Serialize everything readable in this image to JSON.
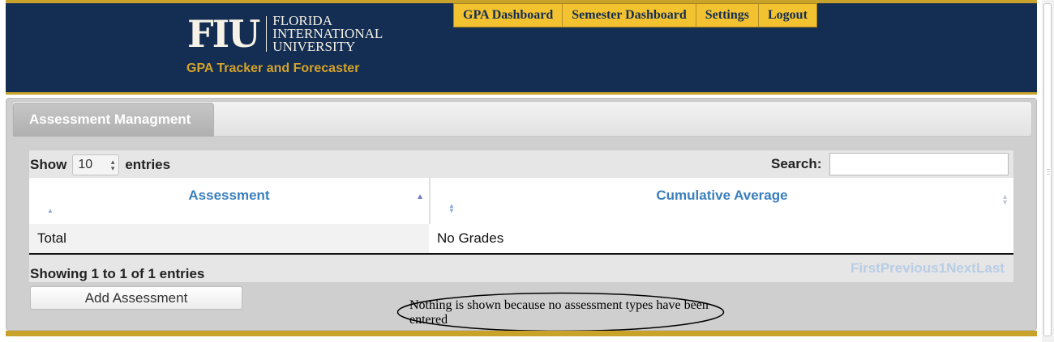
{
  "header": {
    "logo_wordmark": "FIU",
    "logo_line1": "FLORIDA",
    "logo_line2": "INTERNATIONAL",
    "logo_line3": "UNIVERSITY",
    "tagline": "GPA Tracker and Forecaster",
    "nav": [
      "GPA Dashboard",
      "Semester Dashboard",
      "Settings",
      "Logout"
    ]
  },
  "tabs": [
    {
      "label": "Assessment Managment",
      "active": true
    }
  ],
  "table_controls": {
    "show_label": "Show",
    "entries_label": "entries",
    "page_length": "10",
    "search_label": "Search:",
    "search_value": ""
  },
  "table": {
    "columns": [
      "Assessment",
      "Cumulative Average"
    ],
    "rows": [
      [
        "Total",
        "No Grades"
      ]
    ]
  },
  "table_info": "Showing 1 to 1 of 1 entries",
  "pagination": {
    "first": "First",
    "previous": "Previous",
    "page": "1",
    "next": "Next",
    "last": "Last"
  },
  "add_button": "Add Assessment",
  "annotation": "Nothing is shown because no assessment types have been entered",
  "colors": {
    "navy": "#132d53",
    "gold": "#c8a22b",
    "nav_gold": "#f2c230",
    "link_blue": "#3a7fbd"
  }
}
